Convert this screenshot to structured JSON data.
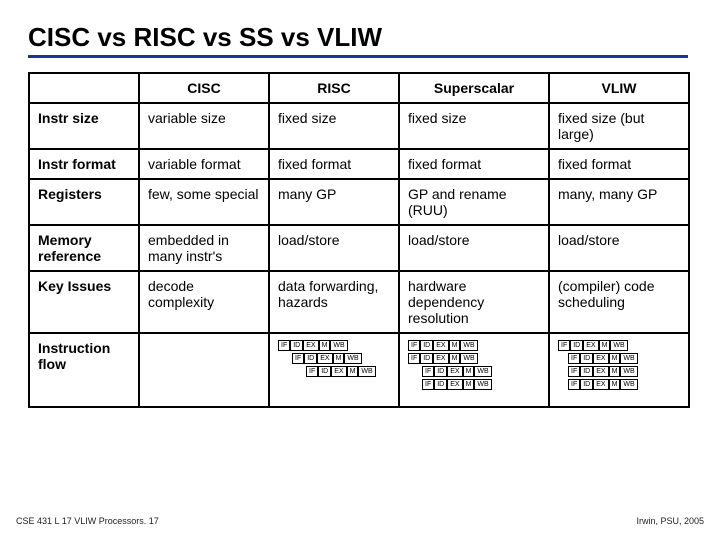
{
  "title": "CISC vs RISC vs SS vs VLIW",
  "columns": [
    "CISC",
    "RISC",
    "Superscalar",
    "VLIW"
  ],
  "rows": [
    {
      "label": "Instr size",
      "cells": [
        "variable size",
        "fixed size",
        "fixed size",
        "fixed size (but large)"
      ]
    },
    {
      "label": "Instr format",
      "cells": [
        "variable format",
        "fixed format",
        "fixed format",
        "fixed format"
      ]
    },
    {
      "label": "Registers",
      "cells": [
        "few, some special",
        "many GP",
        "GP and rename (RUU)",
        "many, many GP"
      ]
    },
    {
      "label": "Memory reference",
      "cells": [
        "embedded in many instr's",
        "load/store",
        "load/store",
        "load/store"
      ]
    },
    {
      "label": "Key Issues",
      "cells": [
        "decode complexity",
        "data forwarding, hazards",
        "hardware dependency resolution",
        "(compiler) code scheduling"
      ]
    }
  ],
  "flow_row_label": "Instruction flow",
  "pipeline_stages": [
    "IF",
    "ID",
    "EX",
    "M",
    "WB"
  ],
  "flow": {
    "risc": {
      "pipes": 3,
      "offsets": [
        0,
        1,
        2
      ]
    },
    "superscalar": {
      "pipes": 4,
      "offsets": [
        0,
        0,
        1,
        1
      ]
    },
    "vliw": {
      "pipes": 4,
      "offsets": [
        0,
        1,
        1,
        1
      ]
    }
  },
  "footer_left": "CSE 431  L 17 VLIW Processors. 17",
  "footer_right": "Irwin, PSU, 2005",
  "chart_data": {
    "type": "table",
    "title": "CISC vs RISC vs SS vs VLIW",
    "columns": [
      "",
      "CISC",
      "RISC",
      "Superscalar",
      "VLIW"
    ],
    "rows": [
      [
        "Instr size",
        "variable size",
        "fixed size",
        "fixed size",
        "fixed size (but large)"
      ],
      [
        "Instr format",
        "variable format",
        "fixed format",
        "fixed format",
        "fixed format"
      ],
      [
        "Registers",
        "few, some special",
        "many GP",
        "GP and rename (RUU)",
        "many, many GP"
      ],
      [
        "Memory reference",
        "embedded in many instr's",
        "load/store",
        "load/store",
        "load/store"
      ],
      [
        "Key Issues",
        "decode complexity",
        "data forwarding, hazards",
        "hardware dependency resolution",
        "(compiler) code scheduling"
      ],
      [
        "Instruction flow",
        "",
        "3 sequential pipelines (IF ID EX M WB)",
        "4 pipelines issued 2-at-a-time (IF ID EX M WB)",
        "4 pipelines, 1 then 3 parallel (IF ID EX M WB)"
      ]
    ]
  }
}
